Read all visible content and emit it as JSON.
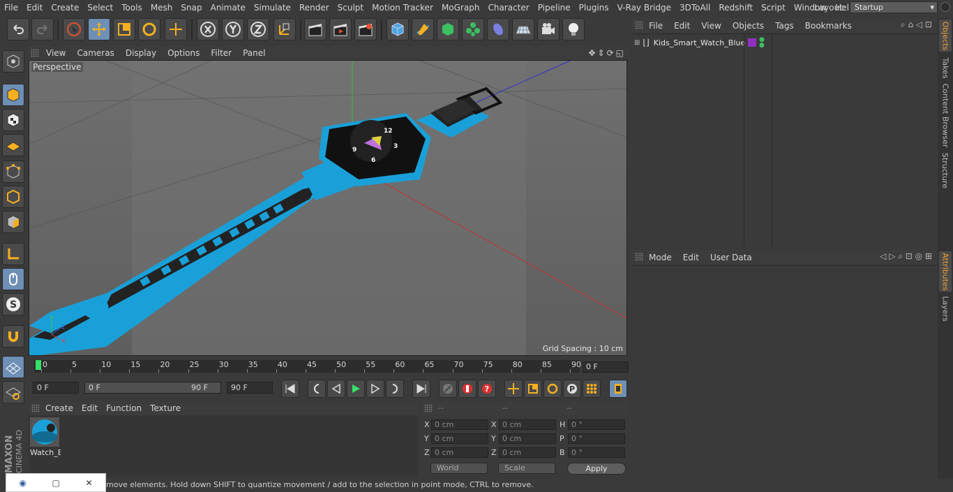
{
  "menubar": {
    "items": [
      "File",
      "Edit",
      "Create",
      "Select",
      "Tools",
      "Mesh",
      "Snap",
      "Animate",
      "Simulate",
      "Render",
      "Sculpt",
      "Motion Tracker",
      "MoGraph",
      "Character",
      "Pipeline",
      "Plugins",
      "V-Ray Bridge",
      "3DToAll",
      "Redshift",
      "Script",
      "Window",
      "Help"
    ],
    "layout_label": "Layout:",
    "layout_value": "Startup"
  },
  "viewport": {
    "menu": [
      "View",
      "Cameras",
      "Display",
      "Options",
      "Filter",
      "Panel"
    ],
    "label": "Perspective",
    "grid_spacing": "Grid Spacing : 10 cm"
  },
  "timeline": {
    "ticks": [
      "0",
      "5",
      "10",
      "15",
      "20",
      "25",
      "30",
      "35",
      "40",
      "45",
      "50",
      "55",
      "60",
      "65",
      "70",
      "75",
      "80",
      "85",
      "90"
    ],
    "current_frame": "0 F"
  },
  "transport": {
    "start_field": "0 F",
    "range_start": "0 F",
    "range_end": "90 F",
    "end_field": "90 F"
  },
  "material": {
    "menu": [
      "Create",
      "Edit",
      "Function",
      "Texture"
    ],
    "name": "Watch_Blue"
  },
  "coordinates": {
    "headers": [
      "--",
      "--",
      "--"
    ],
    "rows": [
      {
        "a": "X",
        "a_val": "0 cm",
        "b": "X",
        "b_val": "0 cm",
        "c": "H",
        "c_val": "0 °"
      },
      {
        "a": "Y",
        "a_val": "0 cm",
        "b": "Y",
        "b_val": "0 cm",
        "c": "P",
        "c_val": "0 °"
      },
      {
        "a": "Z",
        "a_val": "0 cm",
        "b": "Z",
        "b_val": "0 cm",
        "c": "B",
        "c_val": "0 °"
      }
    ],
    "mode": "World",
    "scale": "Scale",
    "apply": "Apply"
  },
  "status": {
    "text": "move elements. Hold down SHIFT to quantize movement / add to the selection in point mode, CTRL to remove."
  },
  "object_manager": {
    "menu": [
      "File",
      "Edit",
      "View",
      "Objects",
      "Tags",
      "Bookmarks"
    ],
    "object_name": "Kids_Smart_Watch_Blue"
  },
  "attribute_manager": {
    "menu": [
      "Mode",
      "Edit",
      "User Data"
    ]
  },
  "right_tabs": [
    "Objects",
    "Takes",
    "Content Browser",
    "Structure",
    "Attributes",
    "Layers"
  ],
  "branding": {
    "maxon": "MAXON",
    "product": "CINEMA 4D"
  },
  "colors": {
    "accent": "#6e8fb6",
    "playhead": "#35e06a",
    "watch_blue": "#1aa0d8",
    "tab_active": "#f0a030"
  }
}
